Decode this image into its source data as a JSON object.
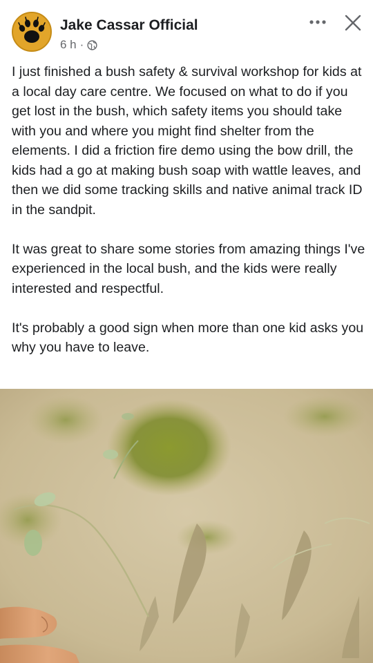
{
  "post": {
    "author": "Jake Cassar Official",
    "time": "6 h",
    "separator": "·",
    "privacy_icon": "globe-icon",
    "more_icon": "more-dots-icon",
    "close_icon": "close-icon",
    "avatar_icon": "paw-print-icon",
    "paragraphs": [
      "I just finished a bush safety & survival workshop for kids at a local day care centre. We focused on what to do if you get lost in the bush, which safety items you should take with you and where you might find shelter from the elements. I did a friction fire demo using the bow drill, the kids had a go at making bush soap with wattle leaves, and then we did some tracking skills and native animal track ID in the sandpit.",
      "It was great to share some stories from amazing things I've experienced in the local bush, and the kids were really interested and respectful.",
      "It's probably a good sign when more than one kid asks you why you have to leave."
    ]
  },
  "colors": {
    "avatar_bg": "#e2a52a",
    "text": "#1c1e21",
    "meta": "#65676b",
    "sand": "#cdbf9c",
    "moss": "#7e8d2e"
  }
}
